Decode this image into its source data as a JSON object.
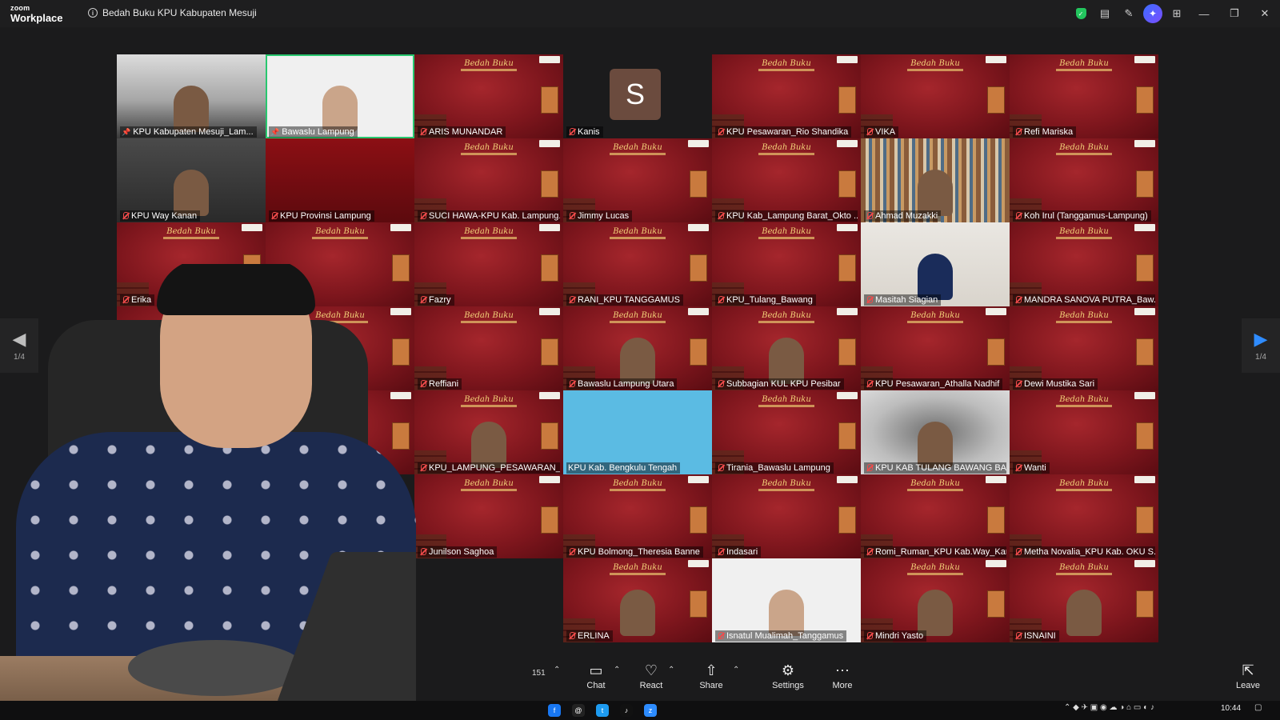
{
  "app": {
    "brand_top": "zoom",
    "brand_bottom": "Workplace",
    "meeting_title": "Bedah Buku KPU Kabupaten Mesuji"
  },
  "titlebar_icons": [
    "security-shield-icon",
    "notes-icon",
    "whiteboard-icon",
    "ai-companion-icon",
    "apps-grid-icon"
  ],
  "window_buttons": [
    "minimize",
    "restore",
    "close"
  ],
  "poster": {
    "title": "Bedah Buku"
  },
  "pagination": {
    "left_label": "1/4",
    "right_label": "1/4"
  },
  "tiles": [
    {
      "name": "KPU Kabupaten Mesuji_Lam...",
      "type": "camera",
      "muted": true,
      "pinned": true
    },
    {
      "name": "Bawaslu Lampung",
      "type": "camera-white",
      "muted": false,
      "pinned": true,
      "active": true
    },
    {
      "name": "ARIS MUNANDAR",
      "type": "poster",
      "muted": true
    },
    {
      "name": "Kanis",
      "type": "avatar",
      "avatar_letter": "S",
      "muted": true
    },
    {
      "name": "KPU Pesawaran_Rio Shandika",
      "type": "poster",
      "muted": true
    },
    {
      "name": "VIKA",
      "type": "poster",
      "muted": true
    },
    {
      "name": "Refi Mariska",
      "type": "poster",
      "muted": true
    },
    {
      "name": "KPU Way Kanan",
      "type": "camera-dark",
      "muted": true
    },
    {
      "name": "KPU Provinsi Lampung",
      "type": "red",
      "muted": true
    },
    {
      "name": "SUCI HAWA-KPU Kab. Lampung...",
      "type": "poster",
      "muted": true
    },
    {
      "name": "Jimmy Lucas",
      "type": "poster",
      "muted": true
    },
    {
      "name": "KPU Kab_Lampung Barat_Okto ...",
      "type": "poster",
      "muted": true
    },
    {
      "name": "Ahmad Muzakki",
      "type": "camera-library",
      "muted": true
    },
    {
      "name": "Koh Irul (Tanggamus-Lampung)",
      "type": "poster",
      "muted": true
    },
    {
      "name": "Erika",
      "type": "poster",
      "muted": true
    },
    {
      "name": "",
      "type": "poster",
      "muted": false
    },
    {
      "name": "Fazry",
      "type": "poster",
      "muted": true
    },
    {
      "name": "RANI_KPU TANGGAMUS",
      "type": "poster",
      "muted": true
    },
    {
      "name": "KPU_Tulang_Bawang",
      "type": "poster",
      "muted": true
    },
    {
      "name": "Masitah Siagian",
      "type": "camera-hijab",
      "muted": true
    },
    {
      "name": "MANDRA SANOVA PUTRA_Baw...",
      "type": "poster",
      "muted": true
    },
    {
      "name": "",
      "type": "poster",
      "muted": false
    },
    {
      "name": "",
      "type": "poster",
      "muted": false
    },
    {
      "name": "Reffiani",
      "type": "poster",
      "muted": true
    },
    {
      "name": "Bawaslu Lampung Utara",
      "type": "poster-person",
      "muted": true
    },
    {
      "name": "Subbagian KUL KPU Pesibar",
      "type": "poster-person",
      "muted": true
    },
    {
      "name": "KPU Pesawaran_Athalla Nadhif",
      "type": "poster",
      "muted": true
    },
    {
      "name": "Dewi Mustika Sari",
      "type": "poster",
      "muted": true
    },
    {
      "name": "",
      "type": "poster",
      "muted": false
    },
    {
      "name": "",
      "type": "poster",
      "muted": false
    },
    {
      "name": "KPU_LAMPUNG_PESAWARAN_M...",
      "type": "poster-person",
      "muted": true
    },
    {
      "name": "KPU Kab. Bengkulu Tengah",
      "type": "blue",
      "muted": false
    },
    {
      "name": "Tirania_Bawaslu Lampung",
      "type": "poster",
      "muted": true
    },
    {
      "name": "KPU KAB TULANG BAWANG BA...",
      "type": "camera-blur",
      "muted": true
    },
    {
      "name": "Wanti",
      "type": "poster",
      "muted": true
    },
    {
      "name": "",
      "type": "empty",
      "muted": false
    },
    {
      "name": "",
      "type": "empty",
      "muted": false
    },
    {
      "name": "Junilson Saghoa",
      "type": "poster",
      "muted": true
    },
    {
      "name": "KPU Bolmong_Theresia Banne",
      "type": "poster",
      "muted": true
    },
    {
      "name": "Indasari",
      "type": "poster",
      "muted": true
    },
    {
      "name": "Romi_Ruman_KPU Kab.Way_Kan...",
      "type": "poster",
      "muted": true
    },
    {
      "name": "Metha Novalia_KPU Kab. OKU S...",
      "type": "poster",
      "muted": true
    },
    {
      "name": "",
      "type": "empty",
      "muted": false
    },
    {
      "name": "",
      "type": "empty",
      "muted": false
    },
    {
      "name": "",
      "type": "empty",
      "muted": false
    },
    {
      "name": "ERLINA",
      "type": "poster-person",
      "muted": true
    },
    {
      "name": "Isnatul Mualimah_Tanggamus",
      "type": "camera-white",
      "muted": true
    },
    {
      "name": "Mindri Yasto",
      "type": "poster-person",
      "muted": true
    },
    {
      "name": "ISNAINI",
      "type": "poster-person",
      "muted": true
    }
  ],
  "toolbar": {
    "participant_count": "151",
    "chat_label": "Chat",
    "react_label": "React",
    "share_label": "Share",
    "settings_label": "Settings",
    "more_label": "More",
    "leave_label": "Leave"
  },
  "taskbar": {
    "time": "10:44"
  }
}
